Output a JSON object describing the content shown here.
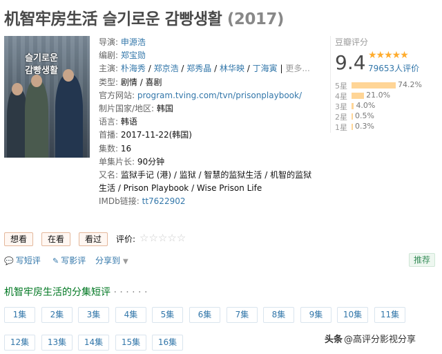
{
  "header": {
    "title": "机智牢房生活 슬기로운 감빵생활",
    "year": "(2017)"
  },
  "poster": {
    "title_line1": "슬기로운",
    "title_line2": "감빵생활"
  },
  "info": {
    "director_label": "导演:",
    "director": "申源浩",
    "writer_label": "编剧:",
    "writer": "郑宝勋",
    "cast_label": "主演:",
    "cast": [
      "朴海秀",
      "郑京浩",
      "郑秀晶",
      "林华映",
      "丁海寅"
    ],
    "cast_more": "更多...",
    "genre_label": "类型:",
    "genre": "剧情 / 喜剧",
    "website_label": "官方网站:",
    "website": "program.tving.com/tvn/prisonplaybook/",
    "country_label": "制片国家/地区:",
    "country": "韩国",
    "language_label": "语言:",
    "language": "韩语",
    "premiere_label": "首播:",
    "premiere": "2017-11-22(韩国)",
    "episodes_label": "集数:",
    "episodes": "16",
    "runtime_label": "单集片长:",
    "runtime": "90分钟",
    "aka_label": "又名:",
    "aka": "监狱手记 (港) / 监狱 / 智慧的监狱生活 / 机智的监狱生活 / Prison Playbook / Wise Prison Life",
    "imdb_label": "IMDb链接:",
    "imdb": "tt7622902"
  },
  "rating": {
    "label": "豆瓣评分",
    "score": "9.4",
    "stars": "★★★★★",
    "count": "79653人评价",
    "distribution": [
      {
        "label": "5星",
        "percent": 74.2,
        "text": "74.2%"
      },
      {
        "label": "4星",
        "percent": 21.0,
        "text": "21.0%"
      },
      {
        "label": "3星",
        "percent": 4.0,
        "text": "4.0%"
      },
      {
        "label": "2星",
        "percent": 0.5,
        "text": "0.5%"
      },
      {
        "label": "1星",
        "percent": 0.3,
        "text": "0.3%"
      }
    ]
  },
  "actions": {
    "want": "想看",
    "watching": "在看",
    "watched": "看过",
    "rate_label": "评价:",
    "rate_stars": "☆☆☆☆☆"
  },
  "links": {
    "short_review": "写短评",
    "review": "写影评",
    "share": "分享到",
    "recommend": "推荐"
  },
  "episodes_section": {
    "title": "机智牢房生活的分集短评",
    "dots": "· · · · · ·",
    "items": [
      "1集",
      "2集",
      "3集",
      "4集",
      "5集",
      "6集",
      "7集",
      "8集",
      "9集",
      "10集",
      "11集",
      "12集",
      "13集",
      "14集",
      "15集",
      "16集"
    ]
  },
  "watermark": {
    "brand": "头条",
    "text": "@高评分影视分享"
  }
}
